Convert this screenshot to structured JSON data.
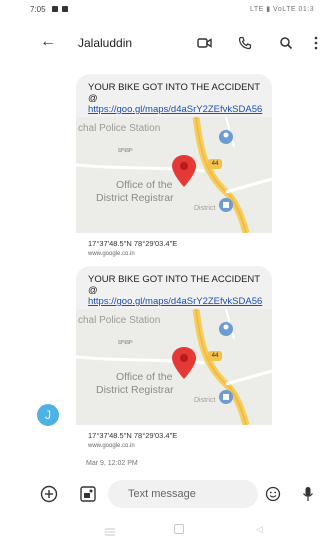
{
  "status_bar": {
    "time": "7:05",
    "right_text": "LTE ▮ VoLTE 01:3"
  },
  "app_bar": {
    "contact_name": "Jalaluddin",
    "icons": [
      "back-arrow-icon",
      "video-call-icon",
      "phone-icon",
      "search-icon",
      "more-vert-icon"
    ]
  },
  "messages": [
    {
      "text_prefix": "YOUR BIKE GOT INTO THE ACCIDENT @ ",
      "link": "https://goo.gl/maps/d4aSrY2ZEfvkSDA56",
      "map_labels": {
        "police": "chal Police Station",
        "telugu": "ఠాణా",
        "office_line1": "Office of the",
        "office_line2": "District Registrar",
        "district": "District",
        "road_shield": "44"
      },
      "coordinates": "17°37'48.5\"N 78°29'03.4\"E",
      "site": "www.google.co.in"
    },
    {
      "text_prefix": "YOUR BIKE GOT INTO THE ACCIDENT @ ",
      "link": "https://goo.gl/maps/d4aSrY2ZEfvkSDA56",
      "map_labels": {
        "police": "chal Police Station",
        "telugu": "ఠాణా",
        "office_line1": "Office of the",
        "office_line2": "District Registrar",
        "district": "District",
        "road_shield": "44"
      },
      "coordinates": "17°37'48.5\"N 78°29'03.4\"E",
      "site": "www.google.co.in"
    }
  ],
  "avatar_letter": "J",
  "timestamp": "Mar 9, 12:02 PM",
  "compose": {
    "placeholder": "Text message"
  },
  "colors": {
    "avatar": "#4fb2e6",
    "link": "#1a4fb5",
    "pin": "#e53935",
    "bubble": "#f1f1f1"
  }
}
